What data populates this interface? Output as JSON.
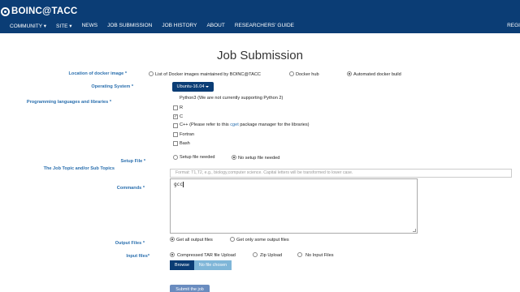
{
  "nav": {
    "logo": "BOINC@TACC",
    "items": [
      "COMMUNITY",
      "SITE",
      "NEWS",
      "JOB SUBMISSION",
      "JOB HISTORY",
      "ABOUT",
      "RESEARCHERS' GUIDE"
    ],
    "right": "REGI"
  },
  "page": {
    "title": "Job Submission"
  },
  "form": {
    "docker_label": "Location of docker image",
    "docker_options": [
      "List of Docker images maintained by BOINC@TACC",
      "Docker hub",
      "Automated docker build"
    ],
    "os_label": "Operating System",
    "os_value": "Ubuntu-16.04",
    "lang_label": "Programming languages and libraries",
    "languages": [
      {
        "label": "Python3 (We are not currently supporting Python 2)"
      },
      {
        "label": "R"
      },
      {
        "label": "C",
        "checked": true
      },
      {
        "label_pre": "C++ (Please refer to this ",
        "link": "cget",
        "label_post": " package manager for the libraries)"
      },
      {
        "label": "Fortran"
      },
      {
        "label": "Bash"
      }
    ],
    "setup_label": "Setup File",
    "setup_options": [
      "Setup file needed",
      "No setup file needed"
    ],
    "topic_label": "The Job Topic and/or Sub Topics",
    "topic_placeholder": "Format: T1,T2, e.g., biology,computer science. Capital letters will be transformed to lower case.",
    "commands_label": "Commands",
    "commands_value": "gcc",
    "output_label": "Output Files",
    "output_options": [
      "Get all output files",
      "Get only some output files"
    ],
    "input_label": "Input files",
    "input_options": [
      "Compressed TAR file Upload",
      "Zip Upload",
      "No Input Files"
    ],
    "browse_label": "Browse",
    "nofile_label": "No file chosen",
    "submit_label": "Submit the job",
    "required_mark": "*"
  },
  "colors": {
    "navbar": "#0b3d75",
    "label": "#2a6fae",
    "nofile": "#7fb6d8"
  }
}
